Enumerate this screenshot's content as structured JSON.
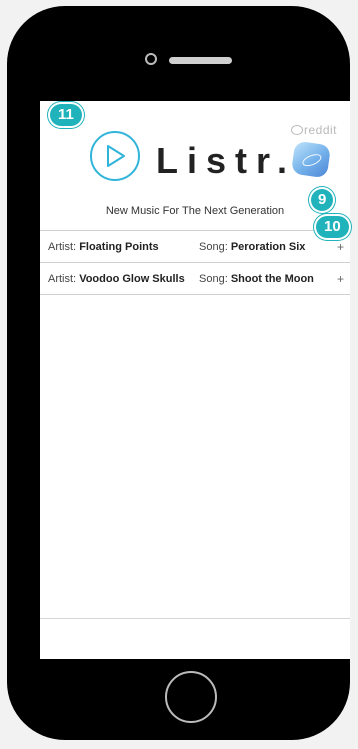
{
  "app": {
    "brand": "Listr.",
    "tagline": "New Music For The Next Generation",
    "source_label": "reddit",
    "back_label": "‹"
  },
  "tracks": [
    {
      "artist_label": "Artist:",
      "artist": "Floating Points",
      "song_label": "Song:",
      "song": "Peroration Six",
      "action": "+"
    },
    {
      "artist_label": "Artist:",
      "artist": "Voodoo Glow Skulls",
      "song_label": "Song:",
      "song": "Shoot the Moon",
      "action": "+"
    }
  ],
  "badges": {
    "b9": "9",
    "b10": "10",
    "b11": "11"
  },
  "colors": {
    "accent": "#31b4d9",
    "badge": "#20b3bb"
  }
}
